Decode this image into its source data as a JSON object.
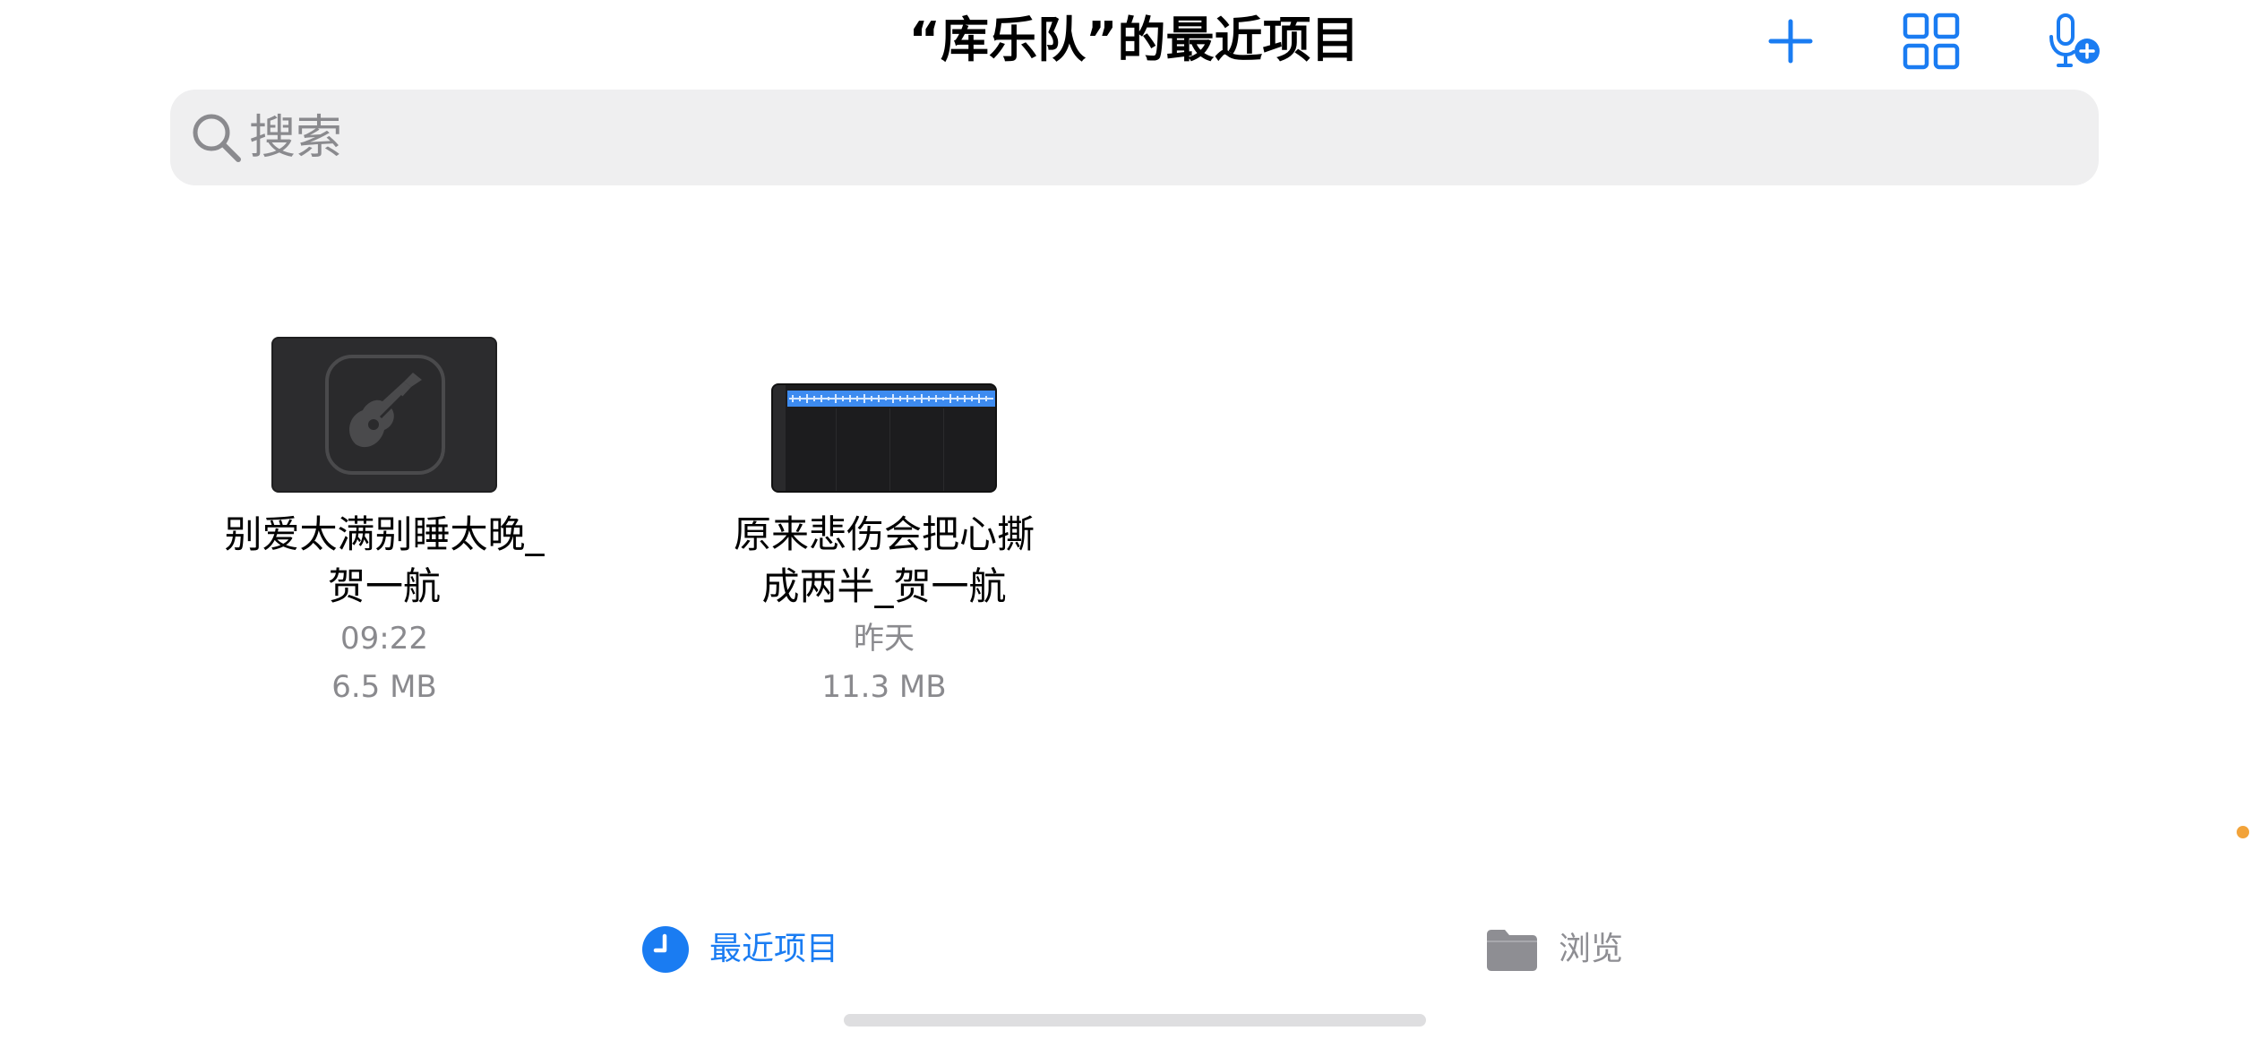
{
  "header": {
    "title": "“库乐队”的最近项目",
    "accent_color": "#1a7cf2",
    "actions": [
      {
        "name": "add",
        "icon": "plus-icon"
      },
      {
        "name": "grid-view",
        "icon": "grid-icon"
      },
      {
        "name": "new-recording",
        "icon": "mic-plus-icon"
      }
    ]
  },
  "search": {
    "placeholder": "搜索",
    "value": ""
  },
  "files": [
    {
      "name_line1": "别爱太满别睡太晚_",
      "name_line2": "贺一航",
      "date": "09:22",
      "size": "6.5 MB",
      "thumbnail": "garageband-guitar-icon"
    },
    {
      "name_line1": "原来悲伤会把心撕",
      "name_line2": "成两半_贺一航",
      "date": "昨天",
      "size": "11.3 MB",
      "thumbnail": "track-waveform-preview"
    }
  ],
  "tabs": [
    {
      "label": "最近项目",
      "icon": "clock-icon",
      "active": true
    },
    {
      "label": "浏览",
      "icon": "folder-icon",
      "active": false
    }
  ],
  "colors": {
    "active_tab": "#1a7cf2",
    "inactive_tab": "#8e8e93",
    "waveform": "#3d8bf0",
    "status_dot": "#f2a33a"
  }
}
